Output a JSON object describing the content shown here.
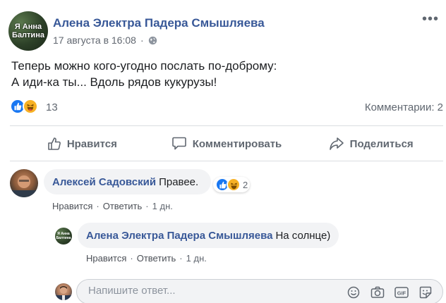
{
  "post": {
    "author": "Алена Электра Падера Смышляева",
    "avatar_text_line1": "Я Анна",
    "avatar_text_line2": "Балтина",
    "date": "17 августа в 16:08",
    "dot": "·",
    "more": "•••",
    "text_line1": "Теперь можно кого-угодно послать по-доброму:",
    "text_line2": "А иди-ка ты... Вдоль рядов кукурузы!",
    "reactions_count": "13",
    "comments_count": "Комментарии: 2",
    "icons": [
      "globe-icon",
      "like-icon",
      "haha-icon",
      "more-icon"
    ]
  },
  "actions": {
    "like": "Нравится",
    "comment": "Комментировать",
    "share": "Поделиться"
  },
  "comments": [
    {
      "name": "Алексей Садовский",
      "text": "Правее.",
      "reactions": "2",
      "like_link": "Нравится",
      "reply_link": "Ответить",
      "time": "1 дн."
    },
    {
      "name": "Алена Электра Падера Смышляева",
      "text": "На солнце)",
      "like_link": "Нравится",
      "reply_link": "Ответить",
      "time": "1 дн."
    }
  ],
  "reply_box": {
    "placeholder": "Напишите ответ...",
    "icons": [
      "emoji-icon",
      "camera-icon",
      "gif-icon",
      "sticker-icon"
    ]
  },
  "colors": {
    "link_blue": "#385898",
    "like_blue": "#1877f2",
    "haha_yellow": "#f7b125",
    "bubble_gray": "#f2f3f5"
  }
}
